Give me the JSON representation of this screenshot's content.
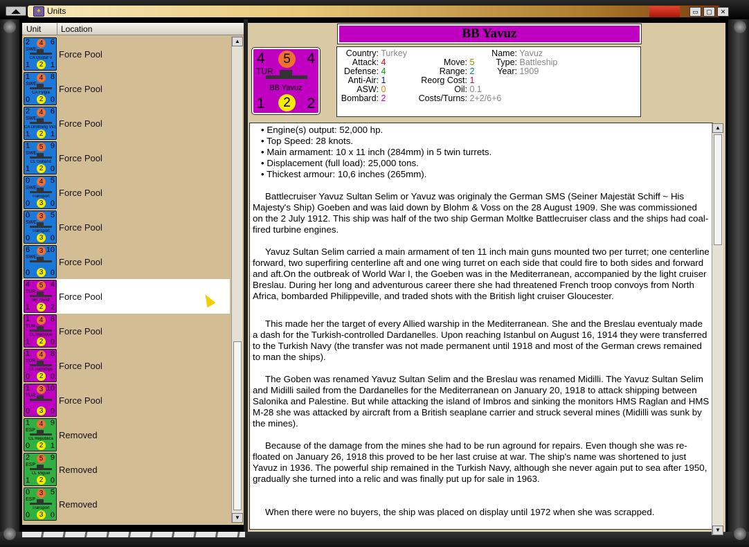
{
  "window": {
    "title": "Units",
    "icon": "app-shield-icon",
    "buttons": [
      "minimize-icon",
      "maximize-icon",
      "close-icon"
    ]
  },
  "list": {
    "columns": [
      "Unit",
      "Location"
    ],
    "rows": [
      {
        "location": "Force Pool",
        "color": "#1a78d8",
        "tl": "2",
        "att": "4",
        "tr": "6",
        "bl": "1",
        "def": "2",
        "br": "1",
        "nat": "SWE",
        "name": "CA Gustaf V"
      },
      {
        "location": "Force Pool",
        "color": "#1a78d8",
        "tl": "1",
        "att": "4",
        "tr": "8",
        "bl": "0",
        "def": "2",
        "br": "0",
        "nat": "SWE",
        "name": "CA Fylgia"
      },
      {
        "location": "Force Pool",
        "color": "#1a78d8",
        "tl": "2",
        "att": "4",
        "tr": "6",
        "bl": "1",
        "def": "2",
        "br": "1",
        "nat": "SWE",
        "name": "CA Drottning Victoria"
      },
      {
        "location": "Force Pool",
        "color": "#1a78d8",
        "tl": "1",
        "att": "5",
        "tr": "9",
        "bl": "1",
        "def": "2",
        "br": "0",
        "nat": "SWE",
        "name": "CL Gotland"
      },
      {
        "location": "Force Pool",
        "color": "#1a78d8",
        "tl": "0",
        "att": "4",
        "tr": "5",
        "bl": "0",
        "def": "3",
        "br": "0",
        "nat": "SWE",
        "name": "Transport"
      },
      {
        "location": "Force Pool",
        "color": "#1a78d8",
        "tl": "0",
        "att": "3",
        "tr": "5",
        "bl": "0",
        "def": "3",
        "br": "0",
        "nat": "SWE",
        "name": "Transport"
      },
      {
        "location": "Force Pool",
        "color": "#1a78d8",
        "tl": "6",
        "att": "3",
        "tr": "10",
        "bl": "0",
        "def": "3",
        "br": "0",
        "nat": "SWE",
        "name": ""
      },
      {
        "location": "Force Pool",
        "color": "#c000c0",
        "tl": "4",
        "att": "5",
        "tr": "4",
        "bl": "1",
        "def": "2",
        "br": "2",
        "nat": "TUR",
        "name": "BB Yavuz",
        "selected": true
      },
      {
        "location": "Force Pool",
        "color": "#c000c0",
        "tl": "1",
        "att": "4",
        "tr": "8",
        "bl": "1",
        "def": "2",
        "br": "0",
        "nat": "TUR",
        "name": "CL Mecidiye"
      },
      {
        "location": "Force Pool",
        "color": "#c000c0",
        "tl": "1",
        "att": "4",
        "tr": "8",
        "bl": "0",
        "def": "2",
        "br": "0",
        "nat": "TUR",
        "name": "CL Hamidiye"
      },
      {
        "location": "Force Pool",
        "color": "#c000c0",
        "tl": "1",
        "att": "3",
        "tr": "10",
        "bl": "0",
        "def": "3",
        "br": "0",
        "nat": "TUR",
        "name": ""
      },
      {
        "location": "Removed",
        "color": "#30b040",
        "tl": "1",
        "att": "4",
        "tr": "9",
        "bl": "0",
        "def": "2",
        "br": "1",
        "nat": "ESP",
        "name": "CL Republica"
      },
      {
        "location": "Removed",
        "color": "#30b040",
        "tl": "2",
        "att": "5",
        "tr": "9",
        "bl": "1",
        "def": "2",
        "br": "0",
        "nat": "ESP",
        "name": "CL Miguel"
      },
      {
        "location": "Removed",
        "color": "#30b040",
        "tl": "0",
        "att": "3",
        "tr": "5",
        "bl": "0",
        "def": "3",
        "br": "0",
        "nat": "ESP",
        "name": "Transport"
      }
    ]
  },
  "detail": {
    "title": "BB Yavuz",
    "counter": {
      "tl": "4",
      "att": "5",
      "tr": "4",
      "nat": "TUR",
      "name": "BB Yavuz",
      "bl": "1",
      "def": "2",
      "br": "2"
    },
    "stats": {
      "country_label": "Country:",
      "country": "Turkey",
      "attack_label": "Attack:",
      "attack": "4",
      "defense_label": "Defense:",
      "defense": "4",
      "antiair_label": "Anti-Air:",
      "antiair": "1",
      "asw_label": "ASW:",
      "asw": "0",
      "bombard_label": "Bombard:",
      "bombard": "2",
      "move_label": "Move:",
      "move": "5",
      "range_label": "Range:",
      "range": "2",
      "reorg_label": "Reorg Cost:",
      "reorg": "1",
      "oil_label": "Oil:",
      "oil": "0.1",
      "costs_label": "Costs/Turns:",
      "costs": "2+2/6+6",
      "name_label": "Name:",
      "name": "Yavuz",
      "type_label": "Type:",
      "type": "Battleship",
      "year_label": "Year:",
      "year": "1909"
    },
    "bullets": [
      "Engine(s) output: 52,000 hp.",
      "Top Speed: 28 knots.",
      "Main armament: 10 x 11 inch (284mm) in 5 twin turrets.",
      "Displacement (full load): 25,000 tons.",
      "Thickest armour: 10,6 inches (265mm)."
    ],
    "paragraphs": [
      "Battlecruiser Yavuz Sultan Selim or Yavuz was originaly the German SMS (Seiner Majestät Schiff ~ His Majesty's Ship) Goeben and was laid down by Blohm & Voss on the 28 August 1909.  She was commissioned on the 2 July 1912.  This ship was half of the two ship German Moltke Battlecruiser class and the ships had coal-fired turbine engines.",
      "Yavuz Sultan Selim carried a main armament of ten 11 inch main guns mounted two per turret; one centerline forward, two superfiring centerline aft and one wing turret on each side that could fire to both sides and forward and aft.On the outbreak of World War I, the Goeben was in the Mediterranean, accompanied by the light cruiser Breslau.  During her long and adventurous career there she had threatened French troop convoys from North Africa, bombarded Philippeville, and traded shots with the British light cruiser Gloucester.",
      "This made her the target of every Allied warship in the Mediterranean.  She and the Breslau eventualy made a dash for the Turkish-controlled Dardanelles. Upon reaching Istanbul on August 16, 1914 they were transferred to the Turkish Navy (the transfer was not made permanent until 1918 and most of the German crews remained to man the ships).",
      "The Goben was renamed Yavuz Sultan Selim and the Breslau was renamed Midilli.  The Yavuz Sultan Selim and Midilli sailed from the Dardanelles for the Mediterranean on January 20, 1918 to attack shipping between Salonika and Palestine.  But while attacking the island of Imbros and sinking the monitors HMS Raglan and HMS M-28 she was attacked by aircraft from a British seaplane carrier and struck several mines (Midilli was sunk by the mines).",
      "Because of the damage from the mines she had to be run aground for repairs. Even though she was re-floated on January 26, 1918 this proved to be her last cruise at war.  The ship's name was shortened to just Yavuz in 1936.  The powerful ship remained in the Turkish Navy, although she never again put to sea after 1950, gradually she turned into a relic and was finally put up for sale in 1963.",
      "When there were no buyers, the ship was placed on display until 1972 when she was scrapped."
    ]
  },
  "colors": {
    "attack": "#e00000",
    "defense": "#00a000",
    "antiair": "#0000c0",
    "asw": "#f08000",
    "bombard": "#c000c0",
    "move": "#a08000",
    "range": "#008080",
    "reorg": "#c00060",
    "gray": "#888888"
  }
}
